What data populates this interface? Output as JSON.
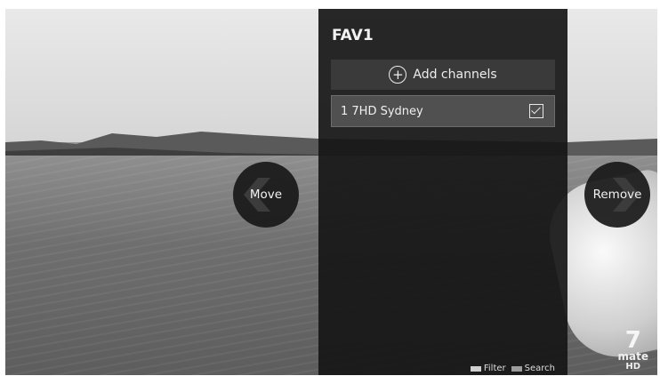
{
  "panel": {
    "title": "FAV1",
    "add_button_label": "Add channels",
    "channels": [
      {
        "label": "1 7HD Sydney",
        "checked": true
      }
    ],
    "footer": {
      "filter_label": "Filter",
      "search_label": "Search"
    }
  },
  "nav": {
    "left_label": "Move",
    "right_label": "Remove"
  },
  "logo": {
    "number": "7",
    "brand": "mate",
    "suffix": "HD"
  },
  "icons": [
    "plus-circle-icon",
    "checkbox-icon",
    "chevron-left-icon",
    "chevron-right-icon"
  ],
  "colors": {
    "panel_bg": "#161616",
    "row_selected": "#505050",
    "button_bg": "#3a3a3a"
  }
}
